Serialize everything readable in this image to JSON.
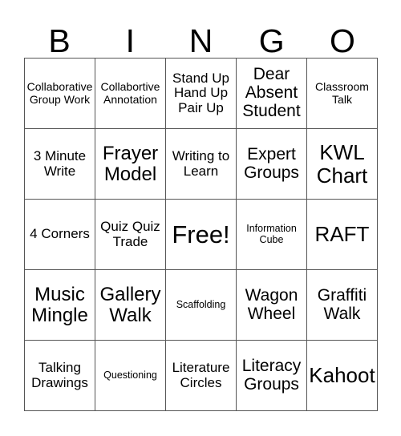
{
  "card": {
    "header_letters": [
      "B",
      "I",
      "N",
      "G",
      "O"
    ],
    "columns": 5,
    "rows": 5,
    "border_color": "#555555",
    "background_color": "#ffffff",
    "text_color": "#000000",
    "cells": [
      {
        "text": "Collaborative Group Work",
        "size": "fs-s"
      },
      {
        "text": "Collabortive Annotation",
        "size": "fs-s"
      },
      {
        "text": "Stand Up Hand Up Pair Up",
        "size": "fs-m"
      },
      {
        "text": "Dear Absent Student",
        "size": "fs-l"
      },
      {
        "text": "Classroom Talk",
        "size": "fs-s"
      },
      {
        "text": "3 Minute Write",
        "size": "fs-m"
      },
      {
        "text": "Frayer Model",
        "size": "fs-xl"
      },
      {
        "text": "Writing to Learn",
        "size": "fs-m"
      },
      {
        "text": "Expert Groups",
        "size": "fs-l"
      },
      {
        "text": "KWL Chart",
        "size": "fs-xxl"
      },
      {
        "text": "4 Corners",
        "size": "fs-m"
      },
      {
        "text": "Quiz Quiz Trade",
        "size": "fs-m"
      },
      {
        "text": "Free!",
        "size": "fs-free"
      },
      {
        "text": "Information Cube",
        "size": "fs-xs"
      },
      {
        "text": "RAFT",
        "size": "fs-xxl"
      },
      {
        "text": "Music Mingle",
        "size": "fs-xl"
      },
      {
        "text": "Gallery Walk",
        "size": "fs-xl"
      },
      {
        "text": "Scaffolding",
        "size": "fs-xs"
      },
      {
        "text": "Wagon Wheel",
        "size": "fs-l"
      },
      {
        "text": "Graffiti Walk",
        "size": "fs-l"
      },
      {
        "text": "Talking Drawings",
        "size": "fs-m"
      },
      {
        "text": "Questioning",
        "size": "fs-xs"
      },
      {
        "text": "Literature Circles",
        "size": "fs-m"
      },
      {
        "text": "Literacy Groups",
        "size": "fs-l"
      },
      {
        "text": "Kahoot",
        "size": "fs-xxl"
      }
    ]
  }
}
